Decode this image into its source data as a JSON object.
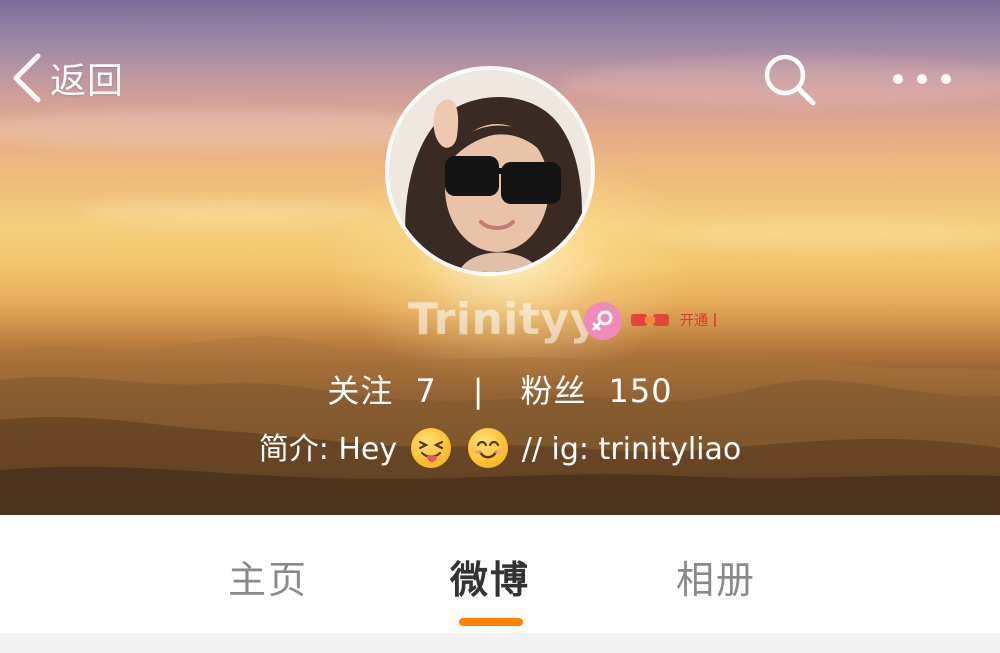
{
  "header": {
    "back_label": "返回",
    "back_icon": "chevron-left-icon",
    "search_icon": "search-icon",
    "more_icon": "more-dots-icon"
  },
  "profile": {
    "username": "Trinityy",
    "gender_icon": "female-icon",
    "vip_badge_label": "开通",
    "stats": {
      "following_label": "关注",
      "following_count": "7",
      "separator": "|",
      "followers_label": "粉丝",
      "followers_count": "150"
    },
    "bio": {
      "prefix": "简介: Hey",
      "emojis": [
        "tongue-out-emoji",
        "smiling-emoji"
      ],
      "suffix": "// ig: trinityliao"
    }
  },
  "tabs": [
    {
      "label": "主页",
      "active": false
    },
    {
      "label": "微博",
      "active": true
    },
    {
      "label": "相册",
      "active": false
    }
  ],
  "colors": {
    "accent": "#ff8200",
    "gender_badge": "#f08bb8",
    "vip_text": "#d63b2f"
  }
}
